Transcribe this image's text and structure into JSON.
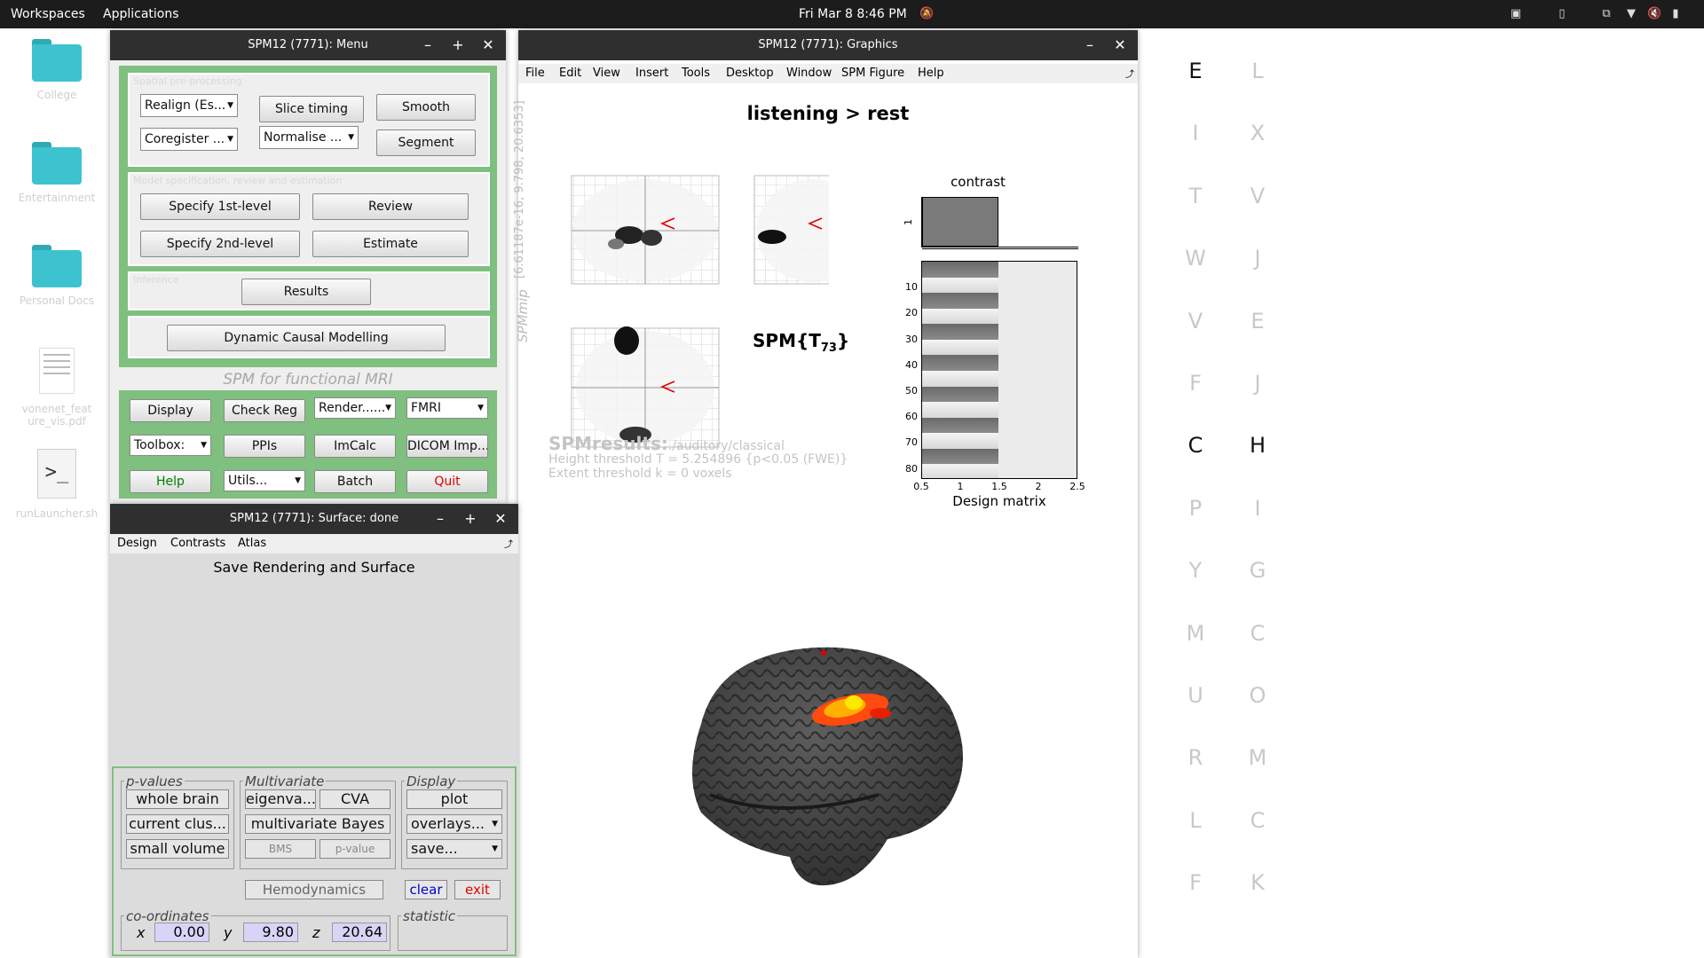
{
  "topbar": {
    "workspaces": "Workspaces",
    "applications": "Applications",
    "datetime": "Fri Mar 8  8:46 PM"
  },
  "desktop": {
    "icons": [
      {
        "label": "College",
        "type": "folder"
      },
      {
        "label": "Entertainment",
        "type": "folder"
      },
      {
        "label": "Personal Docs",
        "type": "folder"
      },
      {
        "label": "vonenet_feature_vis.pdf",
        "type": "document"
      },
      {
        "label": "runLauncher.sh",
        "type": "script"
      }
    ],
    "letters_left": [
      "E",
      "I",
      "T",
      "W",
      "V",
      "F",
      "C",
      "P",
      "Y",
      "M",
      "U",
      "R",
      "L",
      "F"
    ],
    "letters_right": [
      "L",
      "X",
      "V",
      "J",
      "E",
      "J",
      "H",
      "I",
      "G",
      "C",
      "O",
      "M",
      "C",
      "K"
    ]
  },
  "menu_window": {
    "title": "SPM12 (7771): Menu",
    "spatial_title": "Spatial pre-processing",
    "realign": "Realign (Es...",
    "slice_timing": "Slice timing",
    "smooth": "Smooth",
    "coregister": "Coregister ...",
    "normalise": "Normalise ...",
    "segment": "Segment",
    "model_title": "Model specification, review and estimation",
    "specify_1st": "Specify 1st-level",
    "review": "Review",
    "specify_2nd": "Specify 2nd-level",
    "estimate": "Estimate",
    "inference_title": "Inference",
    "results": "Results",
    "dcm": "Dynamic Causal Modelling",
    "subtitle": "SPM for functional MRI",
    "display": "Display",
    "check_reg": "Check Reg",
    "render": "Render......",
    "fmri": "FMRI",
    "toolbox": "Toolbox:",
    "ppis": "PPIs",
    "imcalc": "ImCalc",
    "dicom": "DICOM Imp...",
    "help": "Help",
    "utils": "Utils...",
    "batch": "Batch",
    "quit": "Quit",
    "colors": {
      "frame": "#7fbf7f",
      "help": "#008000",
      "quit": "#e00000"
    }
  },
  "surface_window": {
    "title": "SPM12 (7771): Surface: done",
    "menus": [
      "Design",
      "Contrasts",
      "Atlas"
    ],
    "message": "Save Rendering and Surface",
    "pvalues_label": "p-values",
    "whole_brain": "whole brain",
    "current_cluster": "current clus...",
    "small_volume": "small volume",
    "multivariate_label": "Multivariate",
    "eigenvariate": "eigenva...",
    "cva": "CVA",
    "multivariate_bayes": "multivariate Bayes",
    "bms": "BMS",
    "pvalue": "p-value",
    "display_label": "Display",
    "plot": "plot",
    "overlays": "overlays...",
    "save": "save...",
    "hemodynamics": "Hemodynamics",
    "clear": "clear",
    "exit": "exit",
    "coordinates_label": "co-ordinates",
    "statistic_label": "statistic",
    "x_label": "x",
    "x_value": "0.00",
    "y_label": "y",
    "y_value": "9.80",
    "z_label": "z",
    "z_value": "20.64"
  },
  "graphics_window": {
    "title": "SPM12 (7771): Graphics",
    "menus": [
      "File",
      "Edit",
      "View",
      "Insert",
      "Tools",
      "Desktop",
      "Window",
      "SPM Figure",
      "Help"
    ],
    "contrast_title": "listening > rest",
    "mip_side_label": "SPMmip",
    "mip_coords": "[6.61187e-16, 9.798, 20.6353]",
    "stat_label": "SPM{T",
    "stat_df": "73",
    "stat_close": "}",
    "results_title": "SPMresults:",
    "results_path": "./auditory/classical",
    "height_threshold": "Height threshold T = 5.254896  {p<0.05 (FWE)}",
    "extent_threshold": "Extent threshold k = 0 voxels",
    "contrast_label": "contrast",
    "contrast_ytick": "1",
    "design_label": "Design matrix",
    "design_yticks": [
      "10",
      "20",
      "30",
      "40",
      "50",
      "60",
      "70",
      "80"
    ],
    "design_xticks": [
      "0.5",
      "1",
      "1.5",
      "2",
      "2.5"
    ],
    "colors": {
      "cursor": "#e00000",
      "blob_hot": "#ffe000",
      "blob_warm": "#ff5000"
    }
  }
}
